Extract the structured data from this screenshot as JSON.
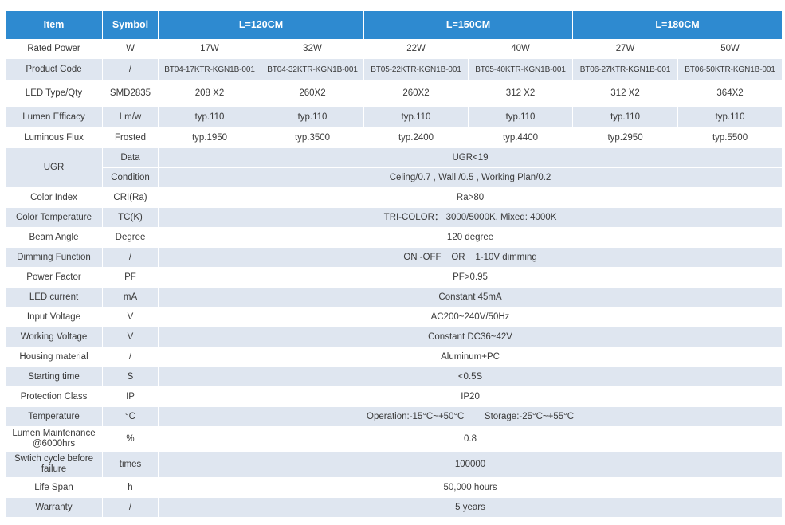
{
  "header": {
    "item": "Item",
    "symbol": "Symbol",
    "groups": [
      "L=120CM",
      "L=150CM",
      "L=180CM"
    ]
  },
  "rows": {
    "rated_power": {
      "item": "Rated Power",
      "symbol": "W",
      "values": [
        "17W",
        "32W",
        "22W",
        "40W",
        "27W",
        "50W"
      ]
    },
    "product_code": {
      "item": "Product Code",
      "symbol": "/",
      "values": [
        "BT04-17KTR-KGN1B-001",
        "BT04-32KTR-KGN1B-001",
        "BT05-22KTR-KGN1B-001",
        "BT05-40KTR-KGN1B-001",
        "BT06-27KTR-KGN1B-001",
        "BT06-50KTR-KGN1B-001"
      ]
    },
    "led_type": {
      "item": "LED Type/Qty",
      "symbol": "SMD2835",
      "values": [
        "208 X2",
        "260X2",
        "260X2",
        "312 X2",
        "312 X2",
        "364X2"
      ]
    },
    "lumen_efficacy": {
      "item": "Lumen Efficacy",
      "symbol": "Lm/w",
      "values": [
        "typ.110",
        "typ.110",
        "typ.110",
        "typ.110",
        "typ.110",
        "typ.110"
      ]
    },
    "luminous_flux": {
      "item": "Luminous Flux",
      "symbol": "Frosted",
      "values": [
        "typ.1950",
        "typ.3500",
        "typ.2400",
        "typ.4400",
        "typ.2950",
        "typ.5500"
      ]
    },
    "ugr": {
      "item": "UGR",
      "symbol_data": "Data",
      "symbol_condition": "Condition",
      "value_data": "UGR<19",
      "value_condition": "Celing/0.7 , Wall /0.5 , Working Plan/0.2"
    },
    "color_index": {
      "item": "Color Index",
      "symbol": "CRI(Ra)",
      "value": "Ra>80"
    },
    "color_temperature": {
      "item": "Color Temperature",
      "symbol": "TC(K)",
      "value": "TRI-COLOR： 3000/5000K, Mixed: 4000K"
    },
    "beam_angle": {
      "item": "Beam Angle",
      "symbol": "Degree",
      "value": "120 degree"
    },
    "dimming": {
      "item": "Dimming Function",
      "symbol": "/",
      "value": "ON -OFF    OR    1-10V dimming"
    },
    "power_factor": {
      "item": "Power Factor",
      "symbol": "PF",
      "value": "PF>0.95"
    },
    "led_current": {
      "item": "LED current",
      "symbol": "mA",
      "value": "Constant 45mA"
    },
    "input_voltage": {
      "item": "Input Voltage",
      "symbol": "V",
      "value": "AC200~240V/50Hz"
    },
    "working_voltage": {
      "item": "Working Voltage",
      "symbol": "V",
      "value": "Constant DC36~42V"
    },
    "housing": {
      "item": "Housing material",
      "symbol": "/",
      "value": "Aluminum+PC"
    },
    "starting_time": {
      "item": "Starting time",
      "symbol": "S",
      "value": "<0.5S"
    },
    "protection": {
      "item": "Protection Class",
      "symbol": "IP",
      "value": "IP20"
    },
    "temperature": {
      "item": "Temperature",
      "symbol": "°C",
      "value": "Operation:-15°C~+50°C        Storage:-25°C~+55°C"
    },
    "lumen_maintenance": {
      "item": "Lumen Maintenance @6000hrs",
      "symbol": "%",
      "value": "0.8"
    },
    "switch_cycle": {
      "item": "Swtich cycle before failure",
      "symbol": "times",
      "value": "100000"
    },
    "life_span": {
      "item": "Life Span",
      "symbol": "h",
      "value": "50,000 hours"
    },
    "warranty": {
      "item": "Warranty",
      "symbol": "/",
      "value": "5 years"
    }
  },
  "colors": {
    "header_bg": "#2e8ad0",
    "row_alt_bg": "#dfe6f0",
    "text": "#3a3a3a"
  }
}
